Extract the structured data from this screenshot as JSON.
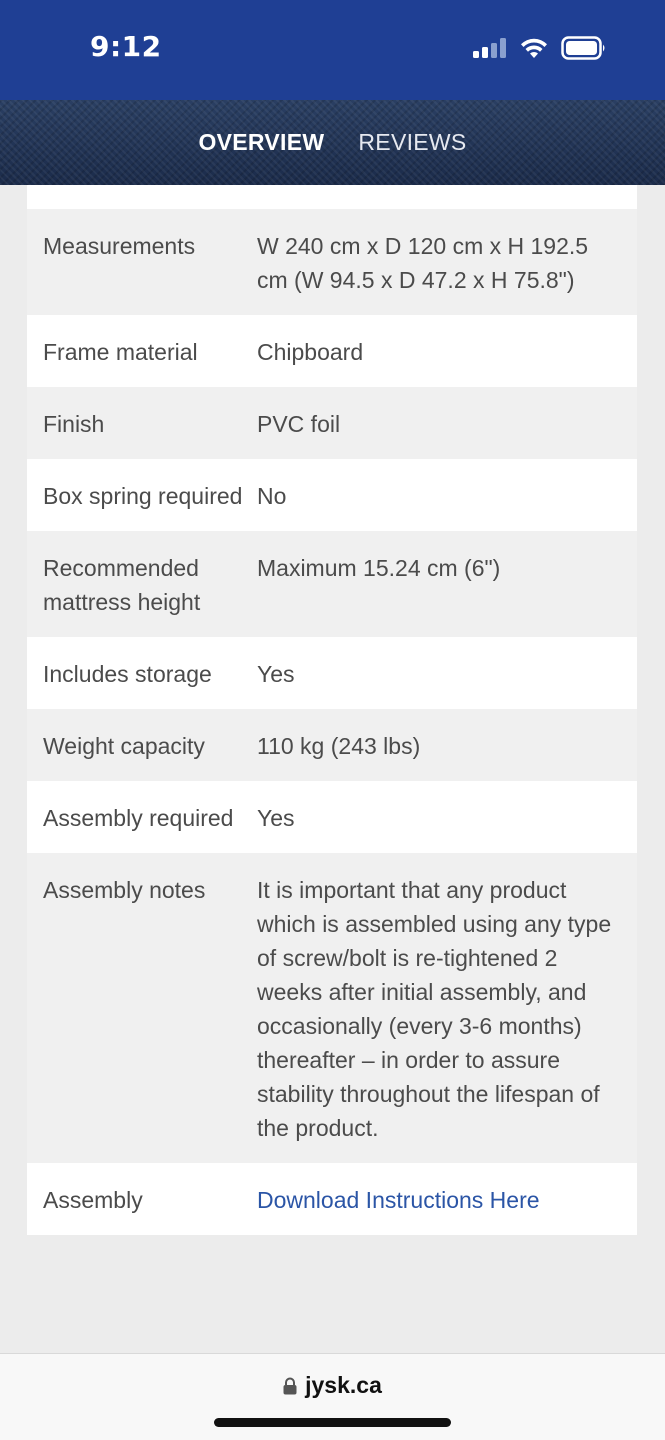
{
  "status_bar": {
    "time": "9:12",
    "signal_icon": "cellular-signal-icon",
    "wifi_icon": "wifi-icon",
    "battery_icon": "battery-icon"
  },
  "nav": {
    "tabs": [
      {
        "label": "OVERVIEW",
        "active": true
      },
      {
        "label": "REVIEWS",
        "active": false
      }
    ]
  },
  "specs": [
    {
      "label": "Measurements",
      "value": "W 240 cm x D 120 cm x H 192.5 cm (W 94.5 x D 47.2 x H 75.8\")"
    },
    {
      "label": "Frame material",
      "value": "Chipboard"
    },
    {
      "label": "Finish",
      "value": "PVC foil"
    },
    {
      "label": "Box spring required",
      "value": "No"
    },
    {
      "label": "Recommended mattress height",
      "value": "Maximum 15.24 cm (6\")"
    },
    {
      "label": "Includes storage",
      "value": "Yes"
    },
    {
      "label": "Weight capacity",
      "value": "110 kg (243 lbs)"
    },
    {
      "label": "Assembly required",
      "value": "Yes"
    },
    {
      "label": "Assembly notes",
      "value": "It is important that any product which is assembled using any type of screw/bolt is re-tightened 2 weeks after initial assembly, and occasionally (every 3-6 months) thereafter – in order to assure stability throughout the lifespan of the product."
    },
    {
      "label": "Assembly",
      "value": "Download Instructions Here"
    }
  ],
  "url_bar": {
    "domain": "jysk.ca",
    "lock_icon": "lock-icon"
  },
  "colors": {
    "header_blue": "#1f3f94",
    "link_blue": "#2b55a6"
  }
}
